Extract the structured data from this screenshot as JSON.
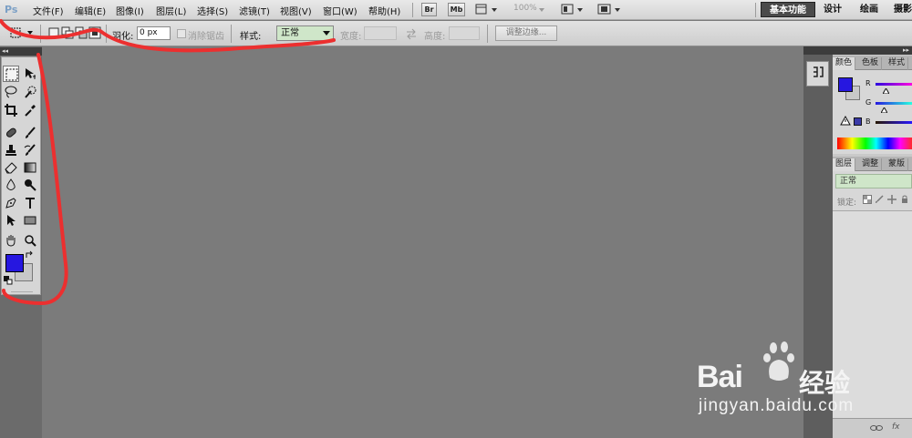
{
  "app": {
    "logo": "Ps"
  },
  "menubar": {
    "items": [
      "文件(F)",
      "编辑(E)",
      "图像(I)",
      "图层(L)",
      "选择(S)",
      "滤镜(T)",
      "视图(V)",
      "窗口(W)",
      "帮助(H)"
    ],
    "bridge_btn": "Br",
    "minibridge_btn": "Mb",
    "zoom": "100%",
    "workspaces": [
      "基本功能",
      "设计",
      "绘画",
      "摄影"
    ]
  },
  "options": {
    "feather_label": "羽化:",
    "feather_value": "0 px",
    "antialias_label": "消除锯齿",
    "style_label": "样式:",
    "style_value": "正常",
    "width_label": "宽度:",
    "height_label": "高度:",
    "refine_edge": "调整边缘..."
  },
  "color_panel": {
    "tabs": [
      "颜色",
      "色板",
      "样式"
    ],
    "channels": [
      "R",
      "G",
      "B"
    ],
    "foreground_color": "#2617e0",
    "background_color": "#c8c8c8"
  },
  "layers_panel": {
    "tabs": [
      "图层",
      "调整",
      "蒙版"
    ],
    "blend_mode": "正常",
    "lock_label": "锁定:"
  },
  "watermark": {
    "brand_left": "Bai",
    "brand_right": "经验",
    "url": "jingyan.baidu.com"
  },
  "colors": {
    "annotation": "#ec2f2f",
    "canvas_bg": "#7b7b7b",
    "style_select_bg": "#cfe6c9"
  }
}
